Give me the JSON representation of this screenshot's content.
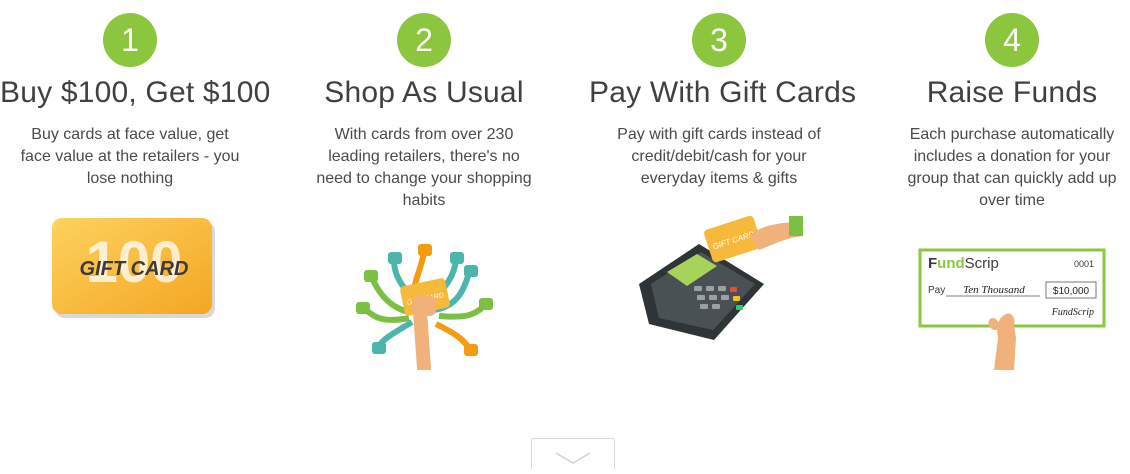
{
  "steps": [
    {
      "number": "1",
      "title": "Buy $100, Get $100",
      "lines": [
        "Buy cards at face value, get",
        "face value at the retailers - you",
        "lose nothing"
      ],
      "card_value": "100",
      "card_label": "GIFT CARD"
    },
    {
      "number": "2",
      "title": "Shop As Usual",
      "lines": [
        "With cards from over 230",
        "leading retailers, there's no",
        "need to change your shopping",
        "habits"
      ],
      "card_label": "GIFT CARD"
    },
    {
      "number": "3",
      "title": "Pay With Gift Cards",
      "lines": [
        "Pay with gift cards instead of",
        "credit/debit/cash for your",
        "everyday items & gifts"
      ],
      "card_label": "GIFT CARD"
    },
    {
      "number": "4",
      "title": "Raise Funds",
      "lines": [
        "Each purchase automatically",
        "includes a donation for your",
        "group that can quickly add up",
        "over time"
      ],
      "check": {
        "brand_prefix": "F",
        "brand_bold": "und",
        "brand_rest": "Scrip",
        "number": "0001",
        "pay_label": "Pay",
        "amount_words": "Ten Thousand",
        "amount": "$10,000",
        "signature": "FundScrip"
      }
    }
  ],
  "colors": {
    "accent": "#8cc63f",
    "gold": "#f6b93b",
    "hand": "#f0b27a"
  }
}
